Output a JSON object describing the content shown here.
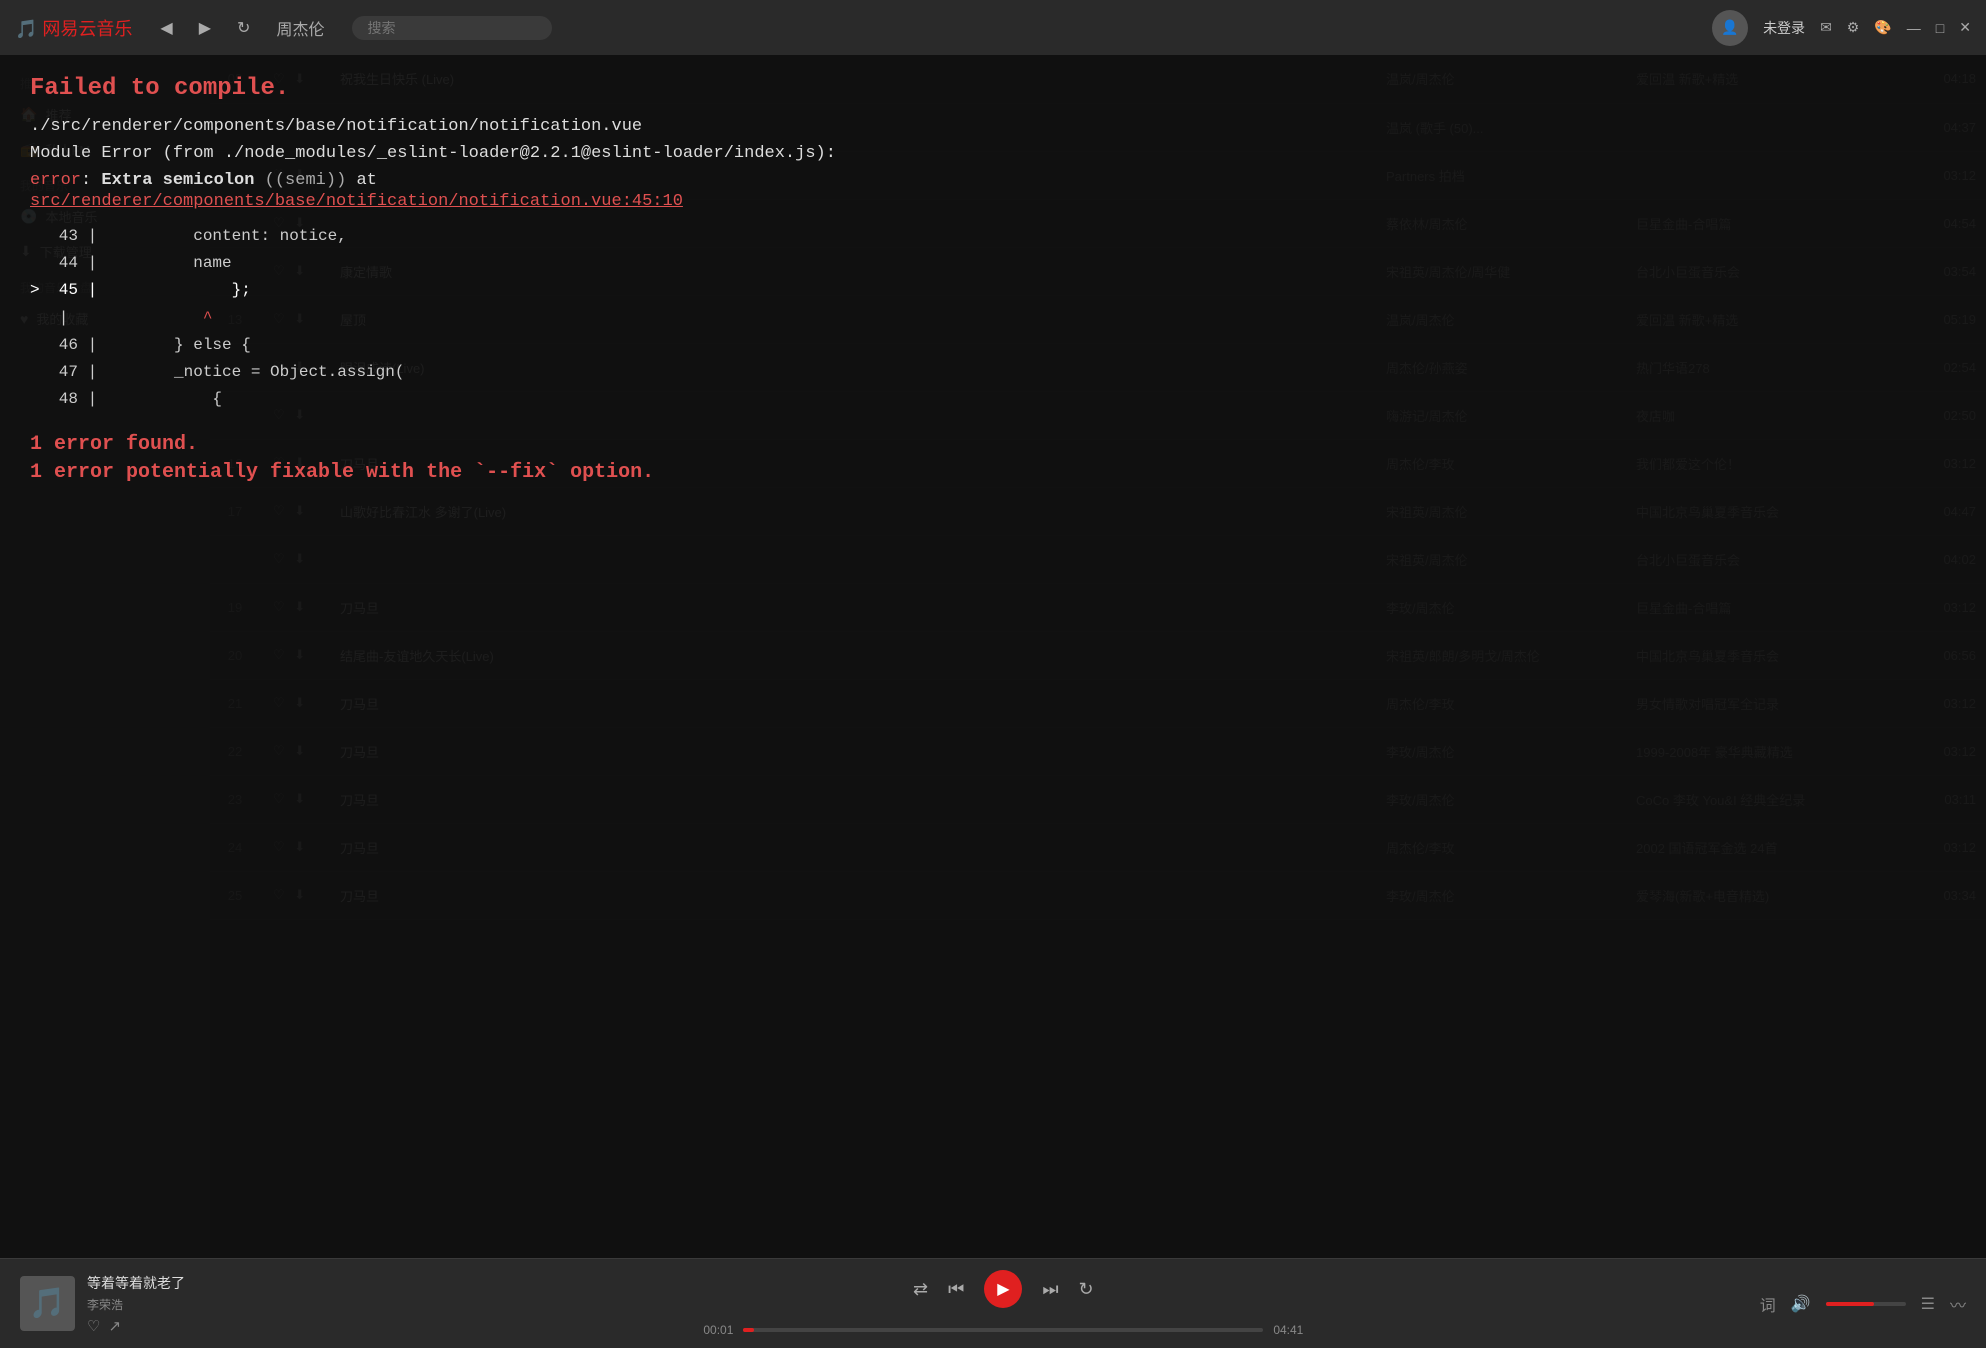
{
  "app": {
    "name": "网易云音乐",
    "title_song": "周杰伦"
  },
  "titlebar": {
    "back_label": "◀",
    "forward_label": "▶",
    "refresh_label": "↻",
    "title": "周杰伦",
    "search_placeholder": "搜索",
    "login_label": "未登录",
    "window_controls": [
      "—",
      "□",
      "✕"
    ]
  },
  "sidebar": {
    "sections": [
      {
        "title": "推荐",
        "items": [
          {
            "label": "推荐"
          },
          {
            "label": "私人FM"
          }
        ]
      },
      {
        "title": "我的音乐",
        "items": [
          {
            "label": "本地音乐"
          },
          {
            "label": "下载管理"
          }
        ]
      },
      {
        "title": "我的音乐云盘",
        "items": [
          {
            "label": "我的收藏"
          }
        ]
      }
    ]
  },
  "playlist": {
    "songs": [
      {
        "num": "08",
        "title": "祝我生日快乐 (Live)",
        "artist": "温岚/周杰伦",
        "album": "爱回温 新歌+精选",
        "duration": "04:18"
      },
      {
        "num": "",
        "title": "",
        "artist": "温岚 (歌手 (50)...",
        "album": "",
        "duration": "04:37"
      },
      {
        "num": "",
        "title": "",
        "artist": "Partners 拍档",
        "album": "",
        "duration": "03:12"
      },
      {
        "num": "",
        "title": "",
        "artist": "蔡依林/周杰伦",
        "album": "巨星金曲-合唱篇",
        "duration": "04:54"
      },
      {
        "num": "",
        "title": "康定情歌",
        "artist": "宋祖英/周杰伦/周华健",
        "album": "台北小巨蛋音乐会",
        "duration": "03:54"
      },
      {
        "num": "13",
        "title": "屋顶",
        "artist": "温岚/周杰伦",
        "album": "爱回温 新歌+精选",
        "duration": "05:19"
      },
      {
        "num": "",
        "title": "眼泪成诗(Live)",
        "artist": "周杰伦/孙燕姿",
        "album": "热门华语278",
        "duration": "02:54"
      },
      {
        "num": "",
        "title": "",
        "artist": "嗨游记/周杰伦",
        "album": "夜店咖",
        "duration": "02:50"
      },
      {
        "num": "16",
        "title": "刀马旦",
        "artist": "周杰伦/李玫",
        "album": "我们都爱这个伦！",
        "duration": "03:12"
      },
      {
        "num": "17",
        "title": "山歌好比春江水 多谢了(Live)",
        "artist": "宋祖英/周杰伦",
        "album": "中国北京鸟巢夏季音乐会",
        "duration": "04:47"
      },
      {
        "num": "",
        "title": "",
        "artist": "宋祖英/周杰伦",
        "album": "台北小巨蛋音乐会",
        "duration": "04:02"
      },
      {
        "num": "19",
        "title": "刀马旦",
        "artist": "李玫/周杰伦",
        "album": "巨星金曲-合唱篇",
        "duration": "03:12"
      },
      {
        "num": "20",
        "title": "结尾曲-友谊地久天长(Live)",
        "artist": "宋祖英/郎朗/多明戈/周杰伦",
        "album": "中国北京鸟巢夏季音乐会",
        "duration": "06:56"
      },
      {
        "num": "21",
        "title": "刀马旦",
        "artist": "周杰伦/李玫",
        "album": "男女情歌对唱冠军全记录",
        "duration": "03:12"
      },
      {
        "num": "22",
        "title": "刀马旦",
        "artist": "李玫/周杰伦",
        "album": "1999-2008年 豪华典藏精选",
        "duration": "03:12"
      },
      {
        "num": "23",
        "title": "刀马旦",
        "artist": "李玫/周杰伦",
        "album": "CoCo 李玫 You&I 经典全纪录",
        "duration": "03:11"
      },
      {
        "num": "24",
        "title": "刀马旦",
        "artist": "周杰伦/李玫",
        "album": "2002 国语冠军金选 24首",
        "duration": "03:12"
      },
      {
        "num": "25",
        "title": "刀马旦",
        "artist": "李玫/周杰伦",
        "album": "爱琴海(新歌+电音精选)",
        "duration": "03:34"
      }
    ]
  },
  "error": {
    "header": "Failed to compile.",
    "file_path": "./src/renderer/components/base/notification/notification.vue",
    "module_error": "Module Error (from ./node_modules/_eslint-loader@2.2.1@eslint-loader/index.js):",
    "error_label": "error",
    "error_desc_bold": "Extra semicolon",
    "error_desc_semi": "(semi)",
    "error_desc_at": "at",
    "error_location": "src/renderer/components/base/notification/notification.vue:45:10",
    "code_lines": [
      {
        "num": "43",
        "marker": " ",
        "content": "        content: notice,"
      },
      {
        "num": "44",
        "marker": " ",
        "content": "        name"
      },
      {
        "num": "45",
        "marker": ">",
        "content": "            };"
      },
      {
        "num": "  ",
        "marker": " ",
        "content": "            ^"
      },
      {
        "num": "46",
        "marker": " ",
        "content": "      } else {"
      },
      {
        "num": "47",
        "marker": " ",
        "content": "      _notice = Object.assign("
      },
      {
        "num": "48",
        "marker": " ",
        "content": "          {"
      }
    ],
    "footer_error_count": "1 error found.",
    "footer_fixable": "1 error potentially fixable with the `--fix` option."
  },
  "player": {
    "track_name": "等着等着就老了",
    "track_artist": "李荣浩",
    "time_current": "00:01",
    "time_total": "04:41",
    "volume_icon": "🔊"
  }
}
